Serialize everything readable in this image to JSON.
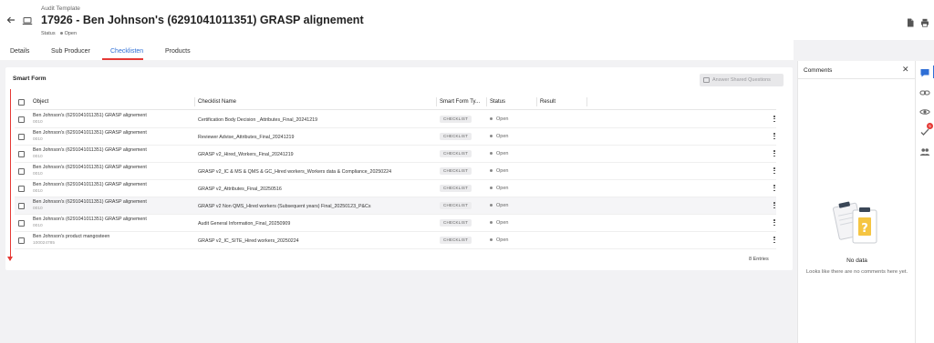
{
  "header": {
    "subtitle": "Audit Template",
    "title": "17926 - Ben Johnson's (6291041011351) GRASP alignement",
    "status_label": "Status",
    "status_value": "Open"
  },
  "tabs": [
    {
      "label": "Details"
    },
    {
      "label": "Sub Producer"
    },
    {
      "label": "Checklisten"
    },
    {
      "label": "Products"
    }
  ],
  "card": {
    "title": "Smart Form",
    "answer_button": "Answer Shared Questions",
    "columns": [
      "Object",
      "Checklist Name",
      "Smart Form Ty...",
      "Status",
      "Result"
    ],
    "entries": "8 Entries",
    "rows": [
      {
        "object": "Ben Johnson's (6291041011351) GRASP alignement",
        "object_sub": "0010",
        "name": "Certification Body Decision _Attributes_Final_20241219",
        "type": "CHECKLIST",
        "status": "Open"
      },
      {
        "object": "Ben Johnson's (6291041011351) GRASP alignement",
        "object_sub": "0010",
        "name": "Reviewer Advise_Attributes_Final_20241219",
        "type": "CHECKLIST",
        "status": "Open"
      },
      {
        "object": "Ben Johnson's (6291041011351) GRASP alignement",
        "object_sub": "0010",
        "name": "GRASP v2_Hired_Workers_Final_20241219",
        "type": "CHECKLIST",
        "status": "Open"
      },
      {
        "object": "Ben Johnson's (6291041011351) GRASP alignement",
        "object_sub": "0010",
        "name": "GRASP v2_IC & MS & QMS & GC_Hired workers_Workers data & Compliance_20250224",
        "type": "CHECKLIST",
        "status": "Open"
      },
      {
        "object": "Ben Johnson's (6291041011351) GRASP alignement",
        "object_sub": "0010",
        "name": "GRASP v2_Attributes_Final_20250516",
        "type": "CHECKLIST",
        "status": "Open"
      },
      {
        "object": "Ben Johnson's (6291041011351) GRASP alignement",
        "object_sub": "0010",
        "name": "GRASP v2 Non QMS_Hired workers (Subsequent years) Final_20250123_P&Cs",
        "type": "CHECKLIST",
        "status": "Open"
      },
      {
        "object": "Ben Johnson's (6291041011351) GRASP alignement",
        "object_sub": "0010",
        "name": "Audit General Information_Final_20250909",
        "type": "CHECKLIST",
        "status": "Open"
      },
      {
        "object": "Ben Johnson's product mangosteen",
        "object_sub": "100024785",
        "name": "GRASP v2_IC_SITE_Hired workers_20250224",
        "type": "CHECKLIST",
        "status": "Open"
      }
    ]
  },
  "comments": {
    "title": "Comments",
    "close": "✕",
    "nodata_title": "No data",
    "nodata_text": "Looks like there are no comments here yet."
  },
  "rail": {
    "badge_count": "5"
  },
  "colors": {
    "accent": "#2f6fd6",
    "highlight_red": "#e53935",
    "badge_bg": "#ececee"
  }
}
